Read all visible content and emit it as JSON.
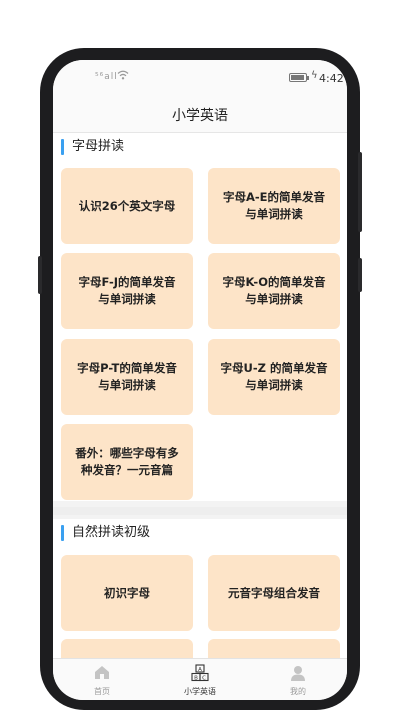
{
  "status": {
    "signal": "⁵⁶all",
    "battery": "100",
    "time": "4:42"
  },
  "header": {
    "title": "小学英语"
  },
  "sections": [
    {
      "title": "字母拼读",
      "cards": [
        "认识26个英文字母",
        "字母A-E的简单发音与单词拼读",
        "字母F-J的简单发音与单词拼读",
        "字母K-O的简单发音与单词拼读",
        "字母P-T的简单发音与单词拼读",
        "字母U-Z 的简单发音与单词拼读",
        "番外：哪些字母有多种发音？一元音篇"
      ]
    },
    {
      "title": "自然拼读初级",
      "cards": [
        "初识字母",
        "元音字母组合发音"
      ]
    }
  ],
  "tabs": [
    {
      "label": "首页",
      "icon": "home-icon"
    },
    {
      "label": "小学英语",
      "icon": "abc-blocks-icon"
    },
    {
      "label": "我的",
      "icon": "person-icon"
    }
  ],
  "colors": {
    "card": "#fde4c8",
    "accent": "#3aa0f0"
  }
}
